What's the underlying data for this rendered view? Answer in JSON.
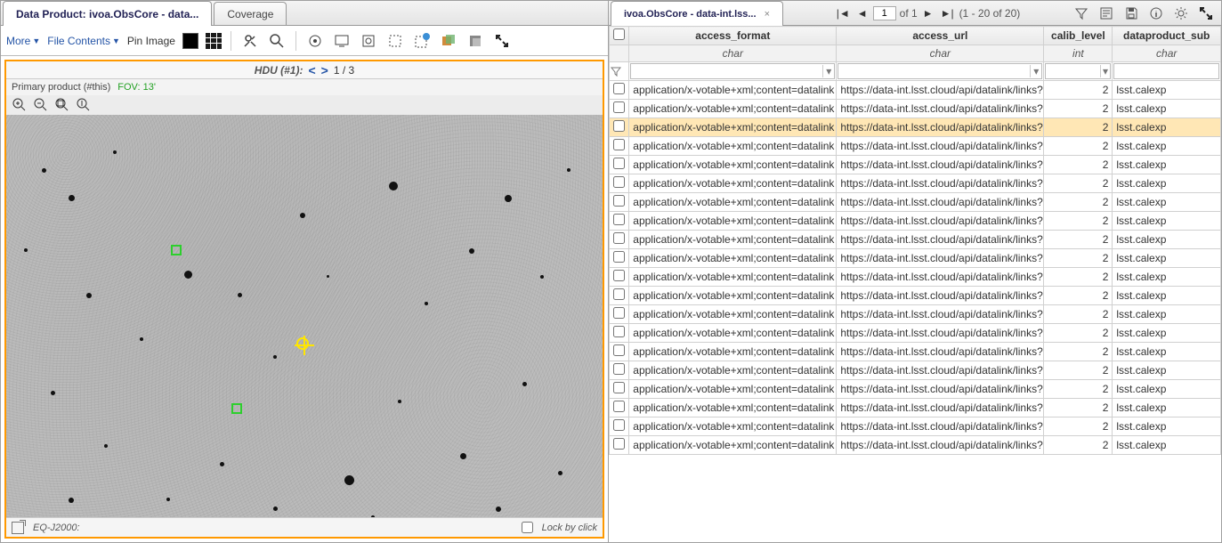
{
  "left": {
    "tabs": {
      "active": "Data Product: ivoa.ObsCore - data...",
      "other": "Coverage"
    },
    "menu": {
      "more": "More",
      "fileContents": "File Contents",
      "pinImage": "Pin Image"
    },
    "hdu": {
      "label": "HDU (#1):",
      "page": "1 / 3"
    },
    "info": {
      "product": "Primary product (#this)",
      "fov": "FOV: 13'"
    },
    "status": {
      "coord": "EQ-J2000:",
      "lock": "Lock by click"
    }
  },
  "right": {
    "tab": "ivoa.ObsCore - data-int.lss...",
    "pager": {
      "page": "1",
      "of": "of 1",
      "range": "(1 - 20 of 20)"
    },
    "columns": {
      "c1": {
        "name": "access_format",
        "type": "char"
      },
      "c2": {
        "name": "access_url",
        "type": "char"
      },
      "c3": {
        "name": "calib_level",
        "type": "int"
      },
      "c4": {
        "name": "dataproduct_sub",
        "type": "char"
      }
    },
    "row_template": {
      "access_format": "application/x-votable+xml;content=datalink",
      "access_url": "https://data-int.lsst.cloud/api/datalink/links?II",
      "calib_level": "2",
      "dataproduct_sub": "lsst.calexp"
    },
    "row_count": 20,
    "highlight_index": 2
  }
}
